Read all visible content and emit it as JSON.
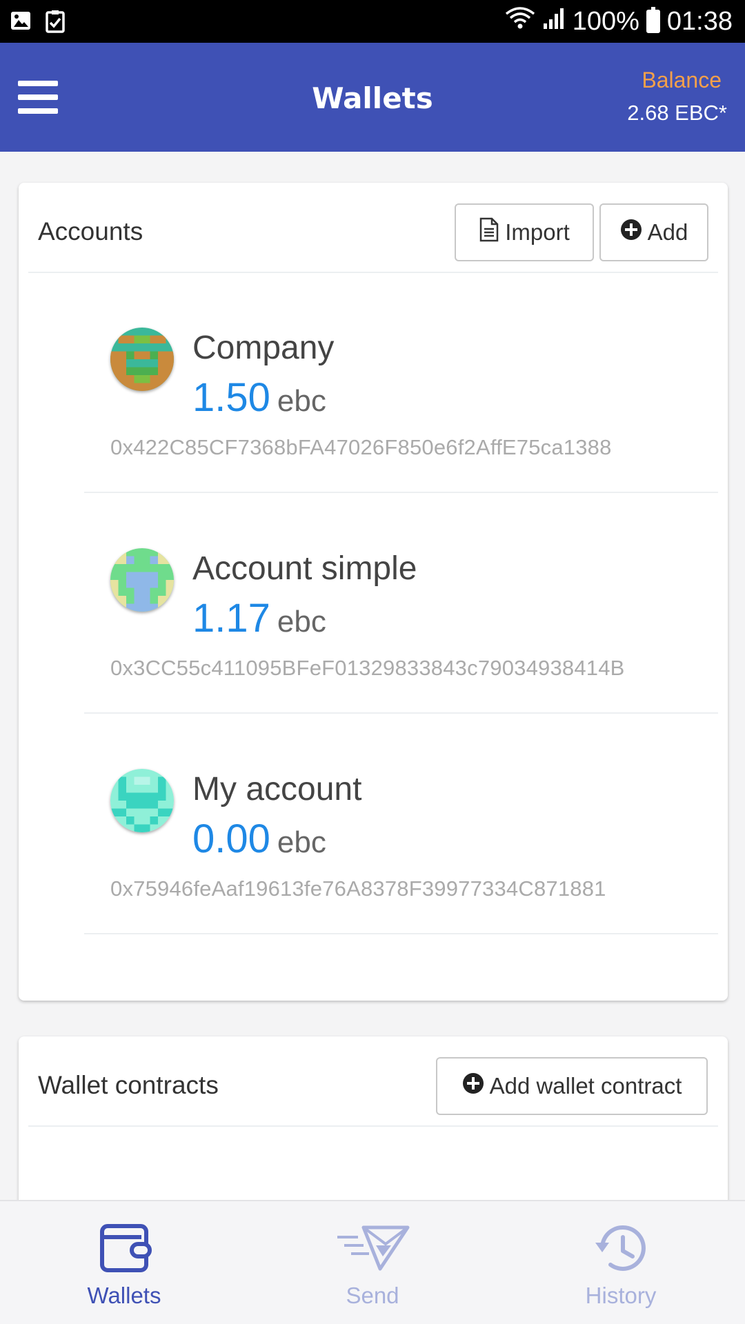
{
  "status_bar": {
    "battery": "100%",
    "time": "01:38"
  },
  "header": {
    "title": "Wallets",
    "balance_label": "Balance",
    "balance_value": "2.68 EBC*"
  },
  "accounts_card": {
    "title": "Accounts",
    "import_label": "Import",
    "add_label": "Add",
    "items": [
      {
        "name": "Company",
        "amount": "1.50",
        "unit": "ebc",
        "address": "0x422C85CF7368bFA47026F850e6f2AffE75ca1388"
      },
      {
        "name": "Account simple",
        "amount": "1.17",
        "unit": "ebc",
        "address": "0x3CC55c411095BFeF01329833843c79034938414B"
      },
      {
        "name": "My account",
        "amount": "0.00",
        "unit": "ebc",
        "address": "0x75946feAaf19613fe76A8378F39977334C871881"
      }
    ]
  },
  "contracts_card": {
    "title": "Wallet contracts",
    "add_label": "Add wallet contract"
  },
  "bottom_nav": {
    "items": [
      {
        "label": "Wallets",
        "icon": "wallet-icon",
        "active": true
      },
      {
        "label": "Send",
        "icon": "send-icon",
        "active": false
      },
      {
        "label": "History",
        "icon": "history-icon",
        "active": false
      }
    ]
  },
  "colors": {
    "primary": "#3f51b5",
    "balance_label": "#f5a04a",
    "amount": "#1e88e5",
    "inactive_nav": "#a8b1dc"
  }
}
